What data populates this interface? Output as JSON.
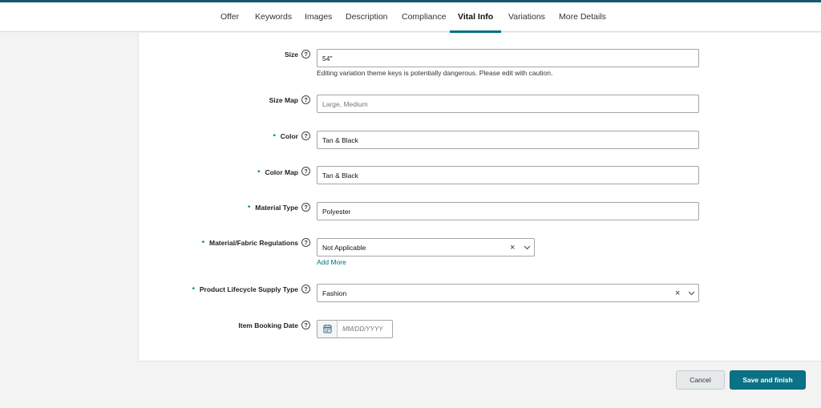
{
  "tabs": [
    {
      "label": "Offer"
    },
    {
      "label": "Keywords"
    },
    {
      "label": "Images"
    },
    {
      "label": "Description"
    },
    {
      "label": "Compliance"
    },
    {
      "label": "Vital Info",
      "active": true
    },
    {
      "label": "Variations"
    },
    {
      "label": "More Details"
    }
  ],
  "form": {
    "size": {
      "label": "Size",
      "required": false,
      "value": "54\"",
      "note": "Editing variation theme keys is potentially dangerous. Please edit with caution."
    },
    "size_map": {
      "label": "Size Map",
      "required": false,
      "value": "",
      "placeholder": "Large, Medium"
    },
    "color": {
      "label": "Color",
      "required": true,
      "value": "Tan & Black"
    },
    "color_map": {
      "label": "Color Map",
      "required": true,
      "value": "Tan & Black"
    },
    "material_type": {
      "label": "Material Type",
      "required": true,
      "value": "Polyester"
    },
    "material_regulations": {
      "label": "Material/Fabric Regulations",
      "required": true,
      "value": "Not Applicable",
      "add_more": "Add More"
    },
    "lifecycle_supply_type": {
      "label": "Product Lifecycle Supply Type",
      "required": true,
      "value": "Fashion"
    },
    "item_booking_date": {
      "label": "Item Booking Date",
      "required": false,
      "value": "",
      "placeholder": "MM/DD/YYYY"
    }
  },
  "required_marker": "*",
  "help_glyph": "?",
  "clear_glyph": "×",
  "icons": {
    "help": "help-circle-icon",
    "clear": "clear-icon",
    "chevron": "chevron-down-icon",
    "calendar": "calendar-icon"
  },
  "colors": {
    "accent": "#007185",
    "save_button": "#0b7285",
    "top_bar": "#125b6e"
  },
  "buttons": {
    "cancel": "Cancel",
    "save": "Save and finish"
  }
}
